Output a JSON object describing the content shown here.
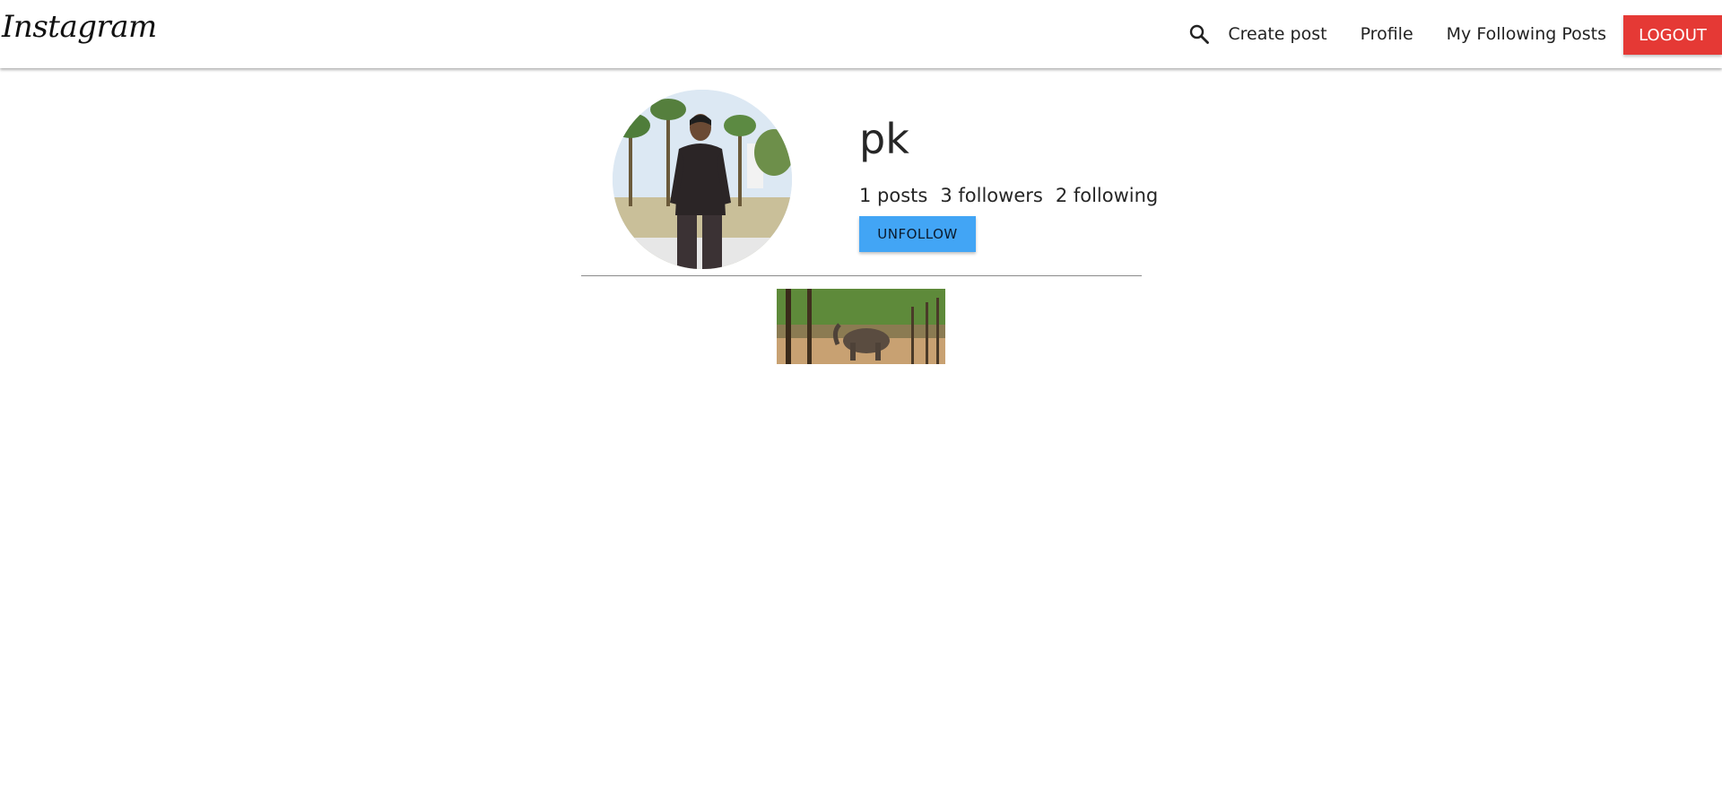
{
  "navbar": {
    "brand": "Instagram",
    "search_icon": "search-icon",
    "links": [
      "Create post",
      "Profile",
      "My Following Posts"
    ],
    "logout_label": "LOGOUT",
    "logout_color": "#e53935"
  },
  "profile": {
    "username": "pk",
    "posts": "1 posts",
    "followers": "3 followers",
    "following": "2 following",
    "unfollow_label": "UNFOLLOW",
    "button_color": "#42a5f5"
  },
  "gallery": {
    "items": [
      "post-image"
    ]
  }
}
